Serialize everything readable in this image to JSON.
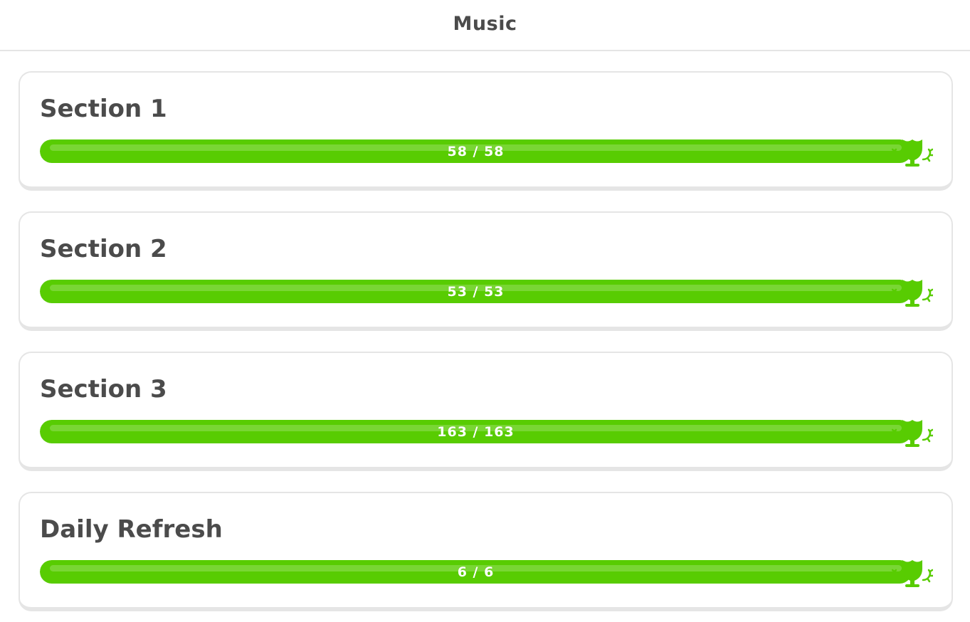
{
  "header": {
    "title": "Music"
  },
  "colors": {
    "progress_fill": "#58cc02",
    "progress_shine": "#79d634",
    "text": "#4b4b4b",
    "border": "#e5e5e5"
  },
  "sections": [
    {
      "title": "Section 1",
      "progress_text": "58 / 58",
      "completed": 58,
      "total": 58,
      "progress": 1.0,
      "icon": "trophy-icon"
    },
    {
      "title": "Section 2",
      "progress_text": "53 / 53",
      "completed": 53,
      "total": 53,
      "progress": 1.0,
      "icon": "trophy-icon"
    },
    {
      "title": "Section 3",
      "progress_text": "163 / 163",
      "completed": 163,
      "total": 163,
      "progress": 1.0,
      "icon": "trophy-icon"
    },
    {
      "title": "Daily Refresh",
      "progress_text": "6 / 6",
      "completed": 6,
      "total": 6,
      "progress": 1.0,
      "icon": "trophy-icon"
    }
  ]
}
